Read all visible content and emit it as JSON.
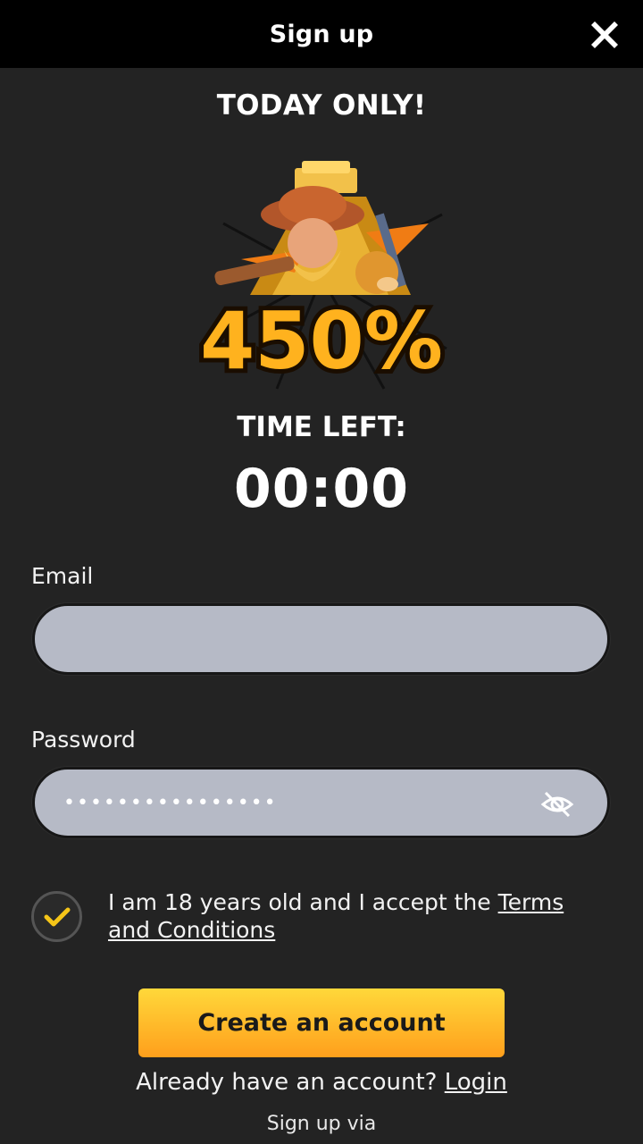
{
  "header": {
    "title": "Sign up",
    "close_icon": "close-icon"
  },
  "promo": {
    "headline": "TODAY ONLY!",
    "bonus_text": "450%",
    "timer_label": "TIME LEFT:",
    "timer_value": "00:00"
  },
  "form": {
    "email_label": "Email",
    "email_value": "",
    "password_label": "Password",
    "password_value": "••••••••••••••••",
    "password_toggle_icon": "eye-off-icon",
    "terms_checked": true,
    "terms_text": "I am 18 years old and I accept the ",
    "terms_link": "Terms and Conditions",
    "submit_label": "Create an account"
  },
  "footer": {
    "login_prompt": "Already have an account? ",
    "login_link": "Login",
    "signup_via": "Sign up via"
  },
  "colors": {
    "background": "#232323",
    "header": "#000000",
    "input": "#b6bac6",
    "accent_yellow": "#ffd83a",
    "accent_orange": "#ff9f1c",
    "check": "#f5c518"
  }
}
